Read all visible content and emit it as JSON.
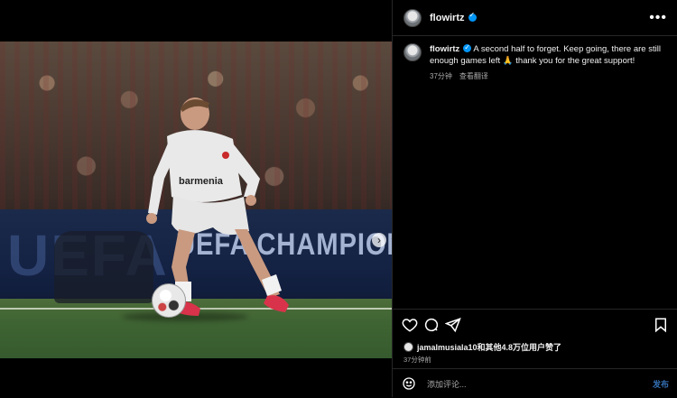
{
  "post": {
    "username": "flowirtz",
    "caption": "A second half to forget. Keep going, there are still enough games left 🙏 thank you for the great support!",
    "posted_ago": "37分钟",
    "translate_label": "查看翻译",
    "jersey_sponsor": "barmenia",
    "board_text": "UEFA CHAMPIONS LE",
    "board_logo": "UEFA"
  },
  "header": {
    "more_icon": "more-horizontal-icon"
  },
  "carousel": {
    "current": 1,
    "total": 2
  },
  "likes": {
    "text": "jamalmusiala10和其他4.8万位用户赞了",
    "time": "37分钟前"
  },
  "comment": {
    "placeholder": "添加评论...",
    "post_label": "发布"
  },
  "colors": {
    "accent": "#0095f6",
    "link": "#4a9eff",
    "divider": "#262626"
  }
}
